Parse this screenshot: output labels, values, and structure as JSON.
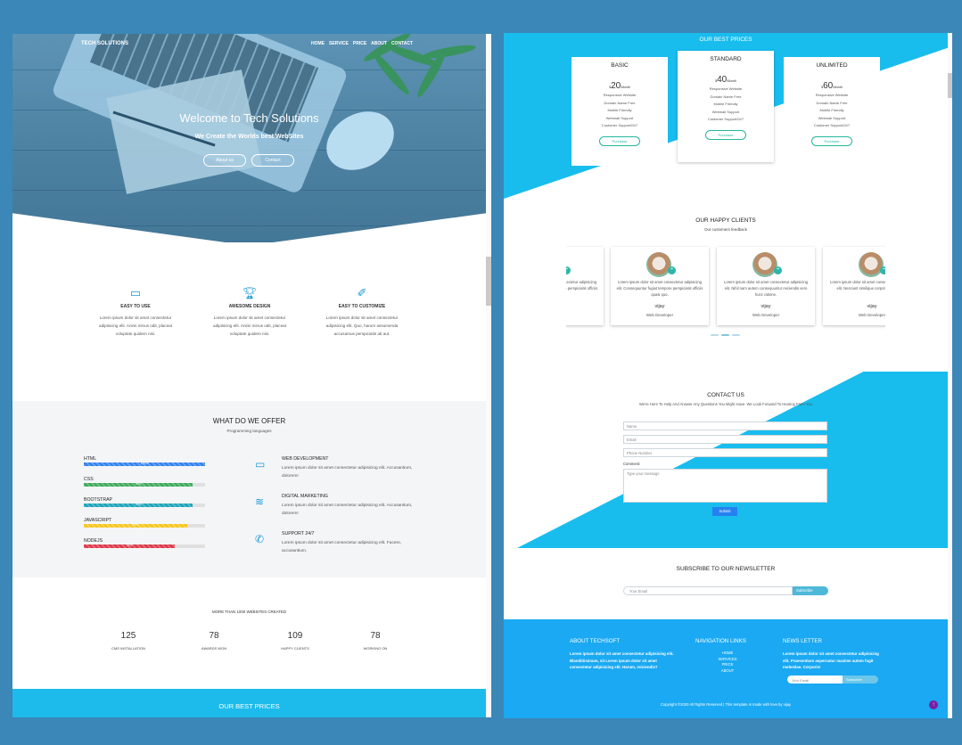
{
  "left": {
    "nav": {
      "brand": "TECH SOLUTIONS",
      "links": [
        "HOME",
        "SERVICE",
        "PRICE",
        "ABOUT",
        "CONTACT"
      ]
    },
    "hero": {
      "title": "Welcome to Tech Solutions",
      "subtitle": "We Create the Worlds best WebSites",
      "btn_about": "About us",
      "btn_contact": "Contact"
    },
    "features": [
      {
        "icon": "monitor-icon",
        "title": "EASY TO USE",
        "desc": "Lorem ipsum dolor sit amet consectetur adipisicing elit. Animi minus odit, placeat voluptate quidem nisi."
      },
      {
        "icon": "trophy-icon",
        "title": "AWESOME DESIGN",
        "desc": "Lorem ipsum dolor sit amet consectetur adipisicing elit. Animi minus odit, placeat voluptate quidem nisi."
      },
      {
        "icon": "magic-wand-icon",
        "title": "EASY TO CUSTOMIZE",
        "desc": "Lorem ipsum dolor sit amet consectetur adipisicing elit. Quo, harum assumenda accusamus perspiciatis ab aut."
      }
    ],
    "offer": {
      "title": "WHAT DO WE OFFER",
      "subtitle": "Programming languages",
      "skills": [
        {
          "name": "HTML",
          "percent": 100,
          "label": "100%",
          "color": "#2f80ed"
        },
        {
          "name": "CSS",
          "percent": 90,
          "label": "90%",
          "color": "#3aa757"
        },
        {
          "name": "BOOTSTRAP",
          "percent": 90,
          "label": "90%",
          "color": "#17a2b8"
        },
        {
          "name": "JAVASCRIPT",
          "percent": 85,
          "label": "85%",
          "color": "#f5c518"
        },
        {
          "name": "NODEJS",
          "percent": 75,
          "label": "75%",
          "color": "#dc3545"
        }
      ],
      "services": [
        {
          "icon": "monitor-icon",
          "title": "WEB DEVELOPMENT",
          "desc": "Lorem ipsum dolor sit amet consectetur adipisicing elit. Accusantium, dolorem!"
        },
        {
          "icon": "wifi-icon",
          "title": "DIGITAL MARKETING",
          "desc": "Lorem ipsum dolor sit amet consectetur adipisicing elit. Accusantium, dolorem!"
        },
        {
          "icon": "phone-icon",
          "title": "SUPPORT 24/7",
          "desc": "Lorem ipsum dolor sit amet consectetur adipisicing elit. Facere, accusantium."
        }
      ]
    },
    "stats": {
      "heading": "MORE THAN 1000 WEBSITES CREATED",
      "items": [
        {
          "value": "125",
          "label": "CMS INSTALLATION"
        },
        {
          "value": "78",
          "label": "AWARDS WON"
        },
        {
          "value": "109",
          "label": "HAPPY CLIENTS"
        },
        {
          "value": "78",
          "label": "WORKING ON"
        }
      ]
    },
    "bottom_title": "OUR BEST PRICES"
  },
  "right": {
    "prices_title": "OUR BEST PRICES",
    "plans": [
      {
        "name": "BASIC",
        "currency": "$",
        "amount": "20",
        "period": "/Month",
        "features": [
          "Responsive Website",
          "Domain Name Free",
          "Mobile Friendly",
          "Webmail Support",
          "Customer Support24/7"
        ],
        "button": "Purchase"
      },
      {
        "name": "STANDARD",
        "currency": "$",
        "amount": "40",
        "period": "/Month",
        "features": [
          "Responsive Website",
          "Domain Name Free",
          "Mobile Friendly",
          "Webmail Support",
          "Customer Support24/7"
        ],
        "button": "Purchase"
      },
      {
        "name": "UNLIMITED",
        "currency": "$",
        "amount": "60",
        "period": "/Month",
        "features": [
          "Responsive Website",
          "Domain Name Free",
          "Mobile Friendly",
          "Webmail Support",
          "Customer Support24/7"
        ],
        "button": "Purchase"
      }
    ],
    "clients": {
      "title": "OUR HAPPY CLIENTS",
      "subtitle": "Our customers feedback",
      "items": [
        {
          "desc": "Lorem ipsum dolor sit amet consectetur adipisicing elit. Consequuntur fugiat tempore perspiciatis officiis",
          "name": "vijay",
          "role": "Developer"
        },
        {
          "desc": "Lorem ipsum dolor sit amet consectetur adipisicing elit. Consequuntur fugiat tempore perspiciatis officiis quasi quo.",
          "name": "vijay",
          "role": "Web Developer"
        },
        {
          "desc": "Lorem ipsum dolor sit amet consectetur adipisicing elit. Nihil nam autem consequuntur reiciendis vero hunc ratione.",
          "name": "vijay",
          "role": "Web Developer"
        },
        {
          "desc": "Lorem ipsum dolor sit amet consectetur adipisicing elit. Nesciunt similique corporis officiis sint.",
          "name": "vijay",
          "role": "Web Developer"
        }
      ]
    },
    "contact": {
      "title": "CONTACT US",
      "subtitle": "We're Here To Help And Answer Any Questions You Might Have. We Look Forward To Hearing From You",
      "name_ph": "Name",
      "email_ph": "Email",
      "phone_ph": "Phone Number",
      "comment_label": "Comment:",
      "comment_ph": "Type your message",
      "submit": "Submit"
    },
    "newsletter": {
      "title": "SUBSCRIBE TO OUR NEWSLETTER",
      "placeholder": "Your Email",
      "button": "Subscribe"
    },
    "footer": {
      "about_title": "ABOUT TECHSOFT",
      "about_text": "Lorem ipsum dolor sit amet consectetur adipisicing elit. Blanditiisimum, sit Lorem ipsum dolor sit amet consectetur adipisicing elit. Harum, reiciendis?",
      "nav_title": "NAVIGATION LINKS",
      "nav_links": [
        "HOME",
        "SERVICES",
        "PRICE",
        "ABOUT"
      ],
      "news_title": "NEWS LETTER",
      "news_text": "Lorem ipsum dolor sit amet consectetur adipisicing elit. Praesentium aspernatur maxime autem fugit molestiae. Corporis!",
      "news_placeholder": "Your Email",
      "news_button": "Subscribe",
      "copyright": "Copyright ©2020 All Rights Reserved | This template is made with love by vijay",
      "to_top": "↑"
    }
  }
}
